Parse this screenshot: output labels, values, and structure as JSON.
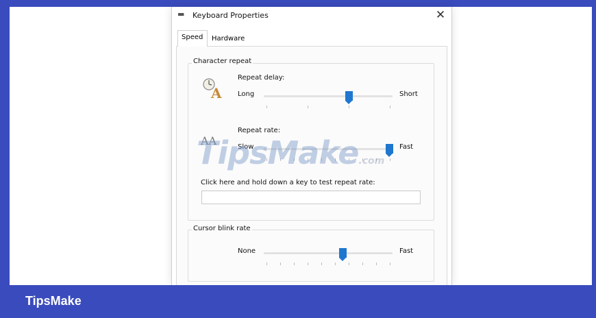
{
  "window": {
    "title": "Keyboard Properties",
    "close_glyph": "✕"
  },
  "tabs": [
    {
      "label": "Speed",
      "selected": true
    },
    {
      "label": "Hardware",
      "selected": false
    }
  ],
  "character_repeat": {
    "group_title": "Character repeat",
    "repeat_delay": {
      "label": "Repeat delay:",
      "min_label": "Long",
      "max_label": "Short",
      "value_fraction": 0.67
    },
    "repeat_rate": {
      "label": "Repeat rate:",
      "min_label": "Slow",
      "max_label": "Fast",
      "value_fraction": 1.0
    },
    "test_prompt": "Click here and hold down a key to test repeat rate:",
    "test_value": ""
  },
  "cursor_blink": {
    "group_title": "Cursor blink rate",
    "min_label": "None",
    "max_label": "Fast",
    "value_fraction": 0.62
  },
  "watermark": {
    "text": "TipsMake",
    "suffix": ".com"
  },
  "footer": {
    "brand": "TipsMake"
  },
  "colors": {
    "frame": "#3a4bbd",
    "slider_thumb": "#1f77d0"
  },
  "icons": [
    "keyboard-icon",
    "close-icon",
    "repeat-delay-icon",
    "repeat-rate-icon"
  ]
}
